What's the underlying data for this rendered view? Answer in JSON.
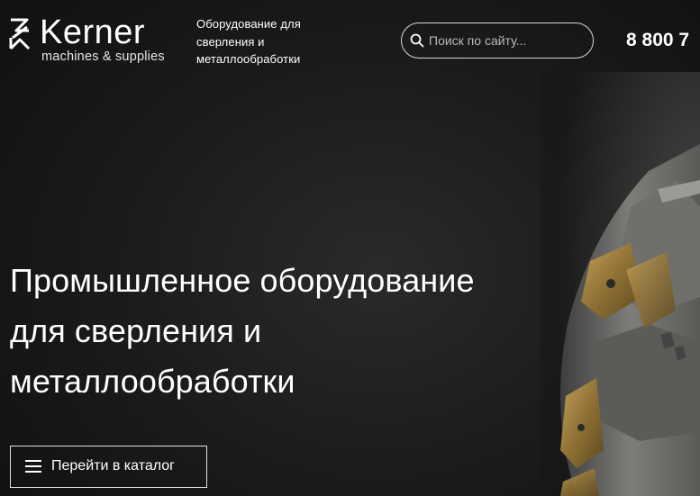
{
  "brand": {
    "name": "Kerner",
    "subtitle": "machines & supplies",
    "tagline_lines": [
      "Оборудование для",
      "сверления и",
      "металлообработки"
    ]
  },
  "search": {
    "placeholder": "Поиск по сайту..."
  },
  "phone": "8 800 7",
  "hero": {
    "title_lines": [
      "Промышленное оборудование",
      "для сверления и",
      "металлообработки"
    ],
    "catalog_button": "Перейти в каталог"
  },
  "icons": {
    "logo": "kerner-logo-icon",
    "search": "search-icon",
    "menu": "burger-menu-icon"
  },
  "colors": {
    "background": "#111111",
    "text": "#ffffff",
    "border": "#d8d8d8",
    "accent_gold": "#9c7f3c"
  }
}
